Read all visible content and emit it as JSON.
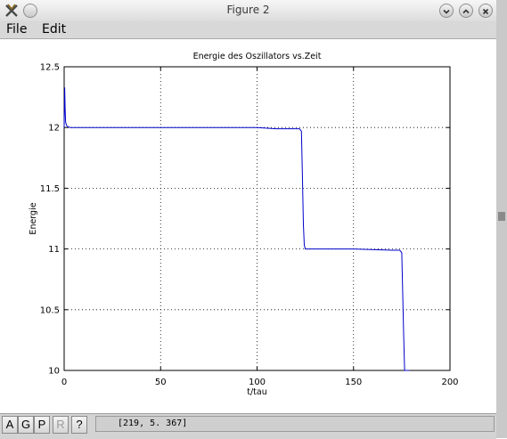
{
  "window": {
    "title": "Figure 2"
  },
  "menu": {
    "file": "File",
    "edit": "Edit"
  },
  "toolbar": {
    "buttons": [
      "A",
      "G",
      "P",
      "R",
      "?"
    ],
    "coords": "[219,  5. 367]"
  },
  "chart_data": {
    "type": "line",
    "title": "Energie des Oszillators vs.Zeit",
    "xlabel": "t/tau",
    "ylabel": "Energie",
    "xlim": [
      0,
      200
    ],
    "ylim": [
      10,
      12.5
    ],
    "xticks": [
      "0",
      "50",
      "100",
      "150",
      "200"
    ],
    "yticks": [
      "10",
      "10.5",
      "11",
      "11.5",
      "12",
      "12.5"
    ],
    "grid": true,
    "line_color": "#0000cc",
    "series": [
      {
        "x": [
          0,
          0.3,
          0.5,
          0.8,
          1.5,
          3,
          10,
          50,
          100,
          110,
          118,
          122,
          123,
          123.5,
          124,
          124.5,
          125,
          126,
          130,
          150,
          170,
          174,
          175,
          176,
          176.5,
          177,
          179
        ],
        "y": [
          12.0,
          12.33,
          12.15,
          12.04,
          12.01,
          12.0,
          12.0,
          12.0,
          12.0,
          11.99,
          11.99,
          11.99,
          11.97,
          11.6,
          11.2,
          11.03,
          11.0,
          11.0,
          11.0,
          11.0,
          10.99,
          10.99,
          10.97,
          10.3,
          10.0,
          10.0,
          10.0
        ]
      }
    ]
  }
}
